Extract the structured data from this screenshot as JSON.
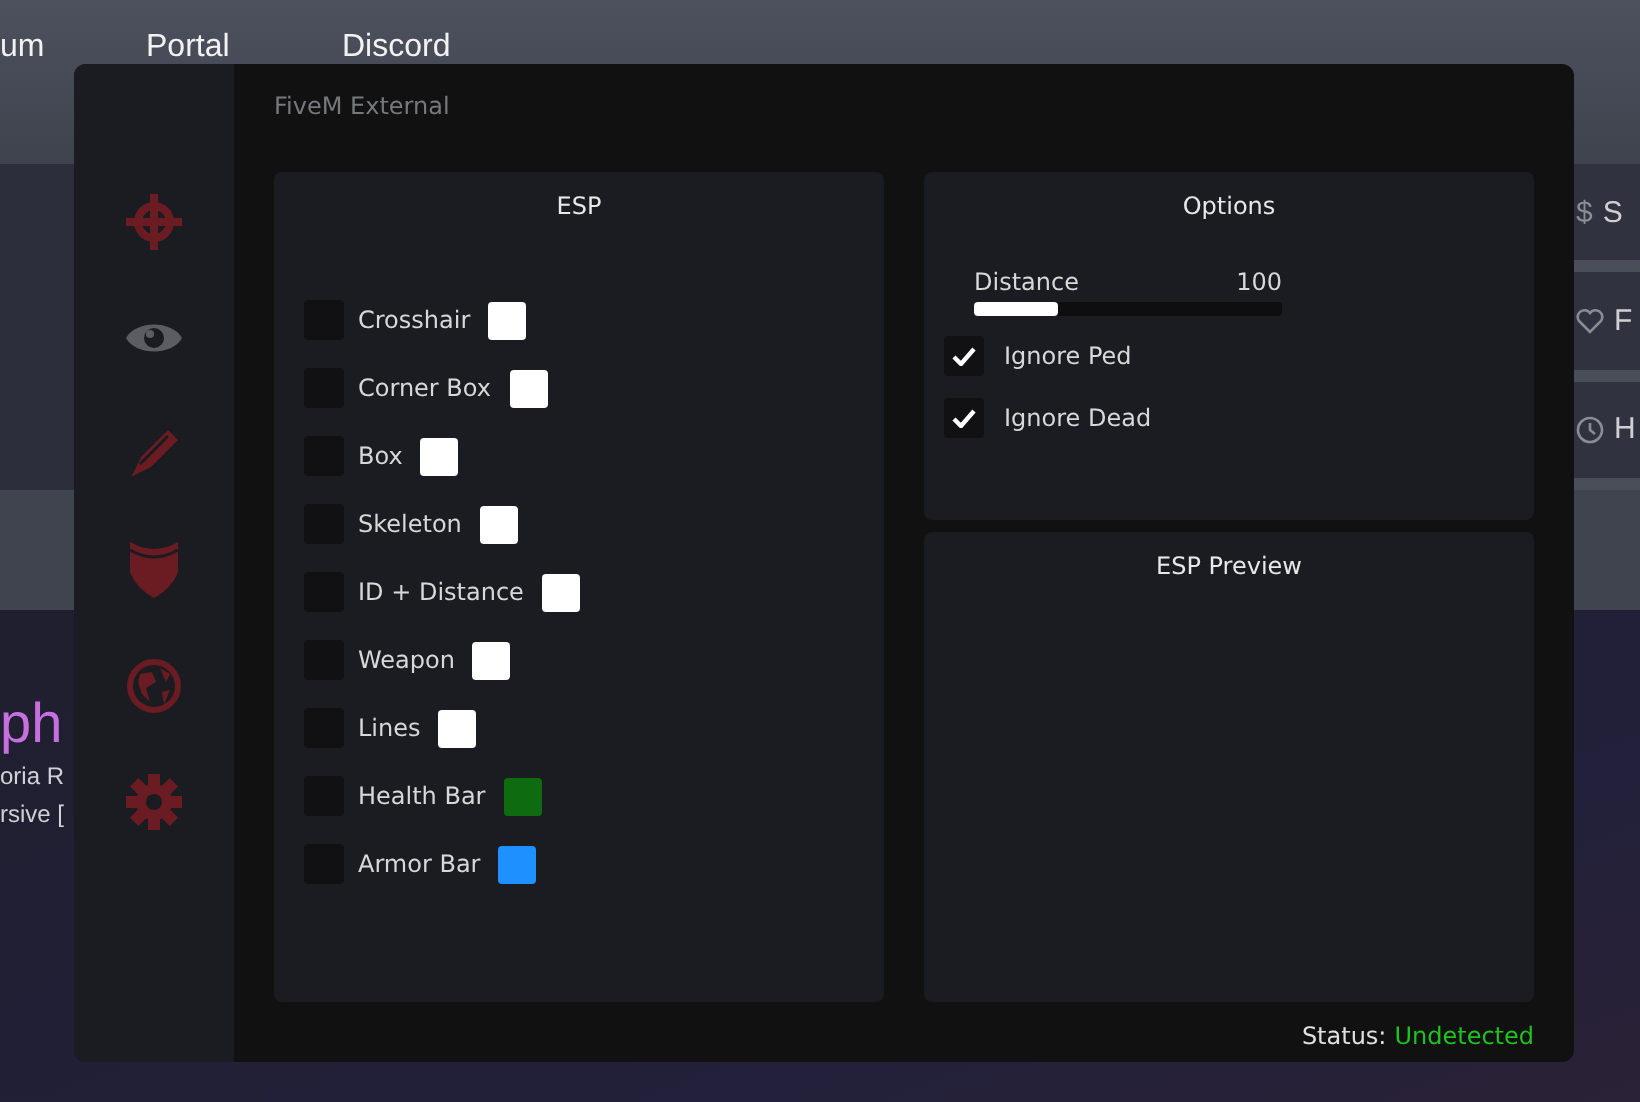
{
  "background_page": {
    "nav": [
      "um",
      "Portal",
      "Discord"
    ],
    "right_items": [
      {
        "symbol": "$",
        "label": "S"
      },
      {
        "label": "F"
      },
      {
        "label": "H"
      }
    ],
    "hero_title": "ph",
    "hero_lines": [
      "oria R",
      "rsive ["
    ]
  },
  "window": {
    "title": "FiveM External",
    "sidebar": [
      {
        "selected": false
      },
      {
        "selected": true
      },
      {
        "selected": false
      },
      {
        "selected": false
      },
      {
        "selected": false
      },
      {
        "selected": false
      }
    ],
    "esp": {
      "title": "ESP",
      "rows": [
        {
          "label": "Crosshair",
          "checked": false,
          "color": "#ffffff"
        },
        {
          "label": "Corner Box",
          "checked": false,
          "color": "#ffffff"
        },
        {
          "label": "Box",
          "checked": false,
          "color": "#ffffff"
        },
        {
          "label": "Skeleton",
          "checked": false,
          "color": "#ffffff"
        },
        {
          "label": "ID + Distance",
          "checked": false,
          "color": "#ffffff"
        },
        {
          "label": "Weapon",
          "checked": false,
          "color": "#ffffff"
        },
        {
          "label": "Lines",
          "checked": false,
          "color": "#ffffff"
        },
        {
          "label": "Health Bar",
          "checked": false,
          "color": "#0f6b10"
        },
        {
          "label": "Armor Bar",
          "checked": false,
          "color": "#1e90ff"
        }
      ]
    },
    "options": {
      "title": "Options",
      "slider": {
        "label": "Distance",
        "reading": "100",
        "level": 0.27
      },
      "toggles": [
        {
          "label": "Ignore Ped",
          "checked": true
        },
        {
          "label": "Ignore Dead",
          "checked": true
        }
      ]
    },
    "preview": {
      "title": "ESP Preview"
    },
    "status": {
      "label": "Status:",
      "value": "Undetected"
    }
  }
}
